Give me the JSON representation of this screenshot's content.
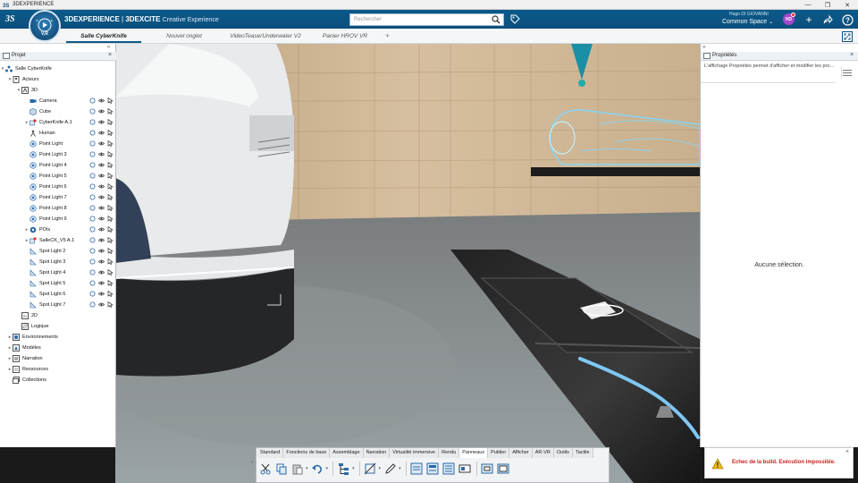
{
  "window": {
    "title": "3DEXPERIENCE",
    "controls": [
      "—",
      "❐",
      "✕"
    ]
  },
  "header": {
    "brand_main": "3DEXPERIENCE",
    "brand_sep": " | ",
    "brand_app": "3DEXCITE",
    "brand_sub": "Creative Experience",
    "compass_label": "V,R",
    "search_placeholder": "Rechercher",
    "user_name": "Hugo DI GIOVANNI",
    "space_name": "Common Space",
    "avatar_initials": "HD"
  },
  "tabs": [
    {
      "label": "Salle CyberKnife",
      "active": true
    },
    {
      "label": "Nouvel onglet",
      "active": false
    },
    {
      "label": "VideoTeaserUnderwater V2",
      "active": false
    },
    {
      "label": "Panier HROV VR",
      "active": false
    }
  ],
  "tab_add": "+",
  "tree_panel": {
    "title": "Projet",
    "close": "×",
    "collapse": "«",
    "rows": [
      {
        "label": "Salle CyberKnife",
        "expander": "▾",
        "icon": "scene-icon"
      },
      {
        "label": "Acteurs",
        "expander": "▾",
        "icon": "actors-icon"
      },
      {
        "label": "3D",
        "expander": "▾",
        "icon": "3d-icon"
      },
      {
        "label": "Camera",
        "expander": "",
        "icon": "camera-icon",
        "controls": true
      },
      {
        "label": "Cube",
        "expander": "",
        "icon": "cube-icon",
        "controls": true
      },
      {
        "label": "CyberKnife A.1",
        "expander": "▸",
        "icon": "model-icon",
        "controls": true
      },
      {
        "label": "Human",
        "expander": "",
        "icon": "human-icon",
        "controls": true
      },
      {
        "label": "Point Light",
        "expander": "",
        "icon": "light-icon",
        "controls": true
      },
      {
        "label": "Point Light 3",
        "expander": "",
        "icon": "light-icon",
        "controls": true
      },
      {
        "label": "Point Light 4",
        "expander": "",
        "icon": "light-icon",
        "controls": true
      },
      {
        "label": "Point Light 5",
        "expander": "",
        "icon": "light-icon",
        "controls": true
      },
      {
        "label": "Point Light 6",
        "expander": "",
        "icon": "light-icon",
        "controls": true
      },
      {
        "label": "Point Light 7",
        "expander": "",
        "icon": "light-icon",
        "controls": true
      },
      {
        "label": "Point Light 8",
        "expander": "",
        "icon": "light-icon",
        "controls": true
      },
      {
        "label": "Point Light 9",
        "expander": "",
        "icon": "light-icon",
        "controls": true
      },
      {
        "label": "POIs",
        "expander": "▸",
        "icon": "poi-icon",
        "controls": true
      },
      {
        "label": "SalleCK_V5 A.1",
        "expander": "▸",
        "icon": "model-icon",
        "controls": true
      },
      {
        "label": "Spot Light 2",
        "expander": "",
        "icon": "spotlight-icon",
        "controls": true
      },
      {
        "label": "Spot Light 3",
        "expander": "",
        "icon": "spotlight-icon",
        "controls": true
      },
      {
        "label": "Spot Light 4",
        "expander": "",
        "icon": "spotlight-icon",
        "controls": true
      },
      {
        "label": "Spot Light 5",
        "expander": "",
        "icon": "spotlight-icon",
        "controls": true
      },
      {
        "label": "Spot Light 6",
        "expander": "",
        "icon": "spotlight-icon",
        "controls": true
      },
      {
        "label": "Spot Light 7",
        "expander": "",
        "icon": "spotlight-icon",
        "controls": true
      },
      {
        "label": "2D",
        "expander": "",
        "icon": "2d-icon"
      },
      {
        "label": "Logique",
        "expander": "",
        "icon": "logic-icon"
      },
      {
        "label": "Environnements",
        "expander": "▸",
        "icon": "environment-icon"
      },
      {
        "label": "Modèles",
        "expander": "▸",
        "icon": "models-icon"
      },
      {
        "label": "Narration",
        "expander": "▸",
        "icon": "narration-icon"
      },
      {
        "label": "Ressources",
        "expander": "▸",
        "icon": "resources-icon"
      },
      {
        "label": "Collections",
        "expander": "",
        "icon": "collections-icon"
      }
    ]
  },
  "props_panel": {
    "title": "Propriétés",
    "close": "×",
    "collapse": "»",
    "description": "L'affichage Propriétés permet d'afficher et modifier les prop...",
    "empty_text": "Aucune sélection."
  },
  "action_bar": {
    "tabs": [
      "Standard",
      "Fonctions de base",
      "Assemblage",
      "Narration",
      "Virtualité immersive",
      "Rendu",
      "Panneaux",
      "Publier",
      "Afficher",
      "AR-VR",
      "Outils",
      "Tactile"
    ],
    "active_tab": "Panneaux",
    "collapse": "‹"
  },
  "notification": {
    "message": "Echec de la build. Exécution impossible.",
    "close": "×"
  },
  "colors": {
    "header_blue": "#0d4f7c",
    "error_red": "#cc1f1f",
    "hologram_cyan": "#7fd8ff",
    "arrow_blue": "#7fc7f2"
  }
}
